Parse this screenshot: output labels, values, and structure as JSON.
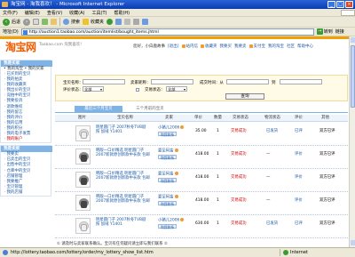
{
  "window": {
    "title": "淘宝网 - 淘我喜欢！ - Microsoft Internet Explorer"
  },
  "menubar": [
    "文件(F)",
    "编辑(E)",
    "查看(V)",
    "收藏(A)",
    "工具(T)",
    "帮助(H)"
  ],
  "toolbar": {
    "back": "后退",
    "search": "搜索",
    "favorites": "收藏夹"
  },
  "address": {
    "label": "地址(D)",
    "url": "http://auction1.taobao.com/auction/itemlist/bought_items.jhtml",
    "go": "转到",
    "links": "链接"
  },
  "page": {
    "logo": "淘宝网",
    "logo_sub": "Taobao.com 淘我喜欢!",
    "topnav": [
      "您好，小白鹿故事",
      "[退出]",
      "站内信",
      "收藏夹",
      "我要买",
      "我要卖",
      "支付宝",
      "我的淘宝",
      "社区",
      "帮助中心"
    ],
    "sidebar": {
      "buyer_head": "我是买家",
      "buyer_sub": "• 我的淘宝 • 我的买家",
      "buyer_items": [
        "已买到的宝贝",
        "我的拍卖",
        "我的收藏夹",
        "我出价的宝贝",
        "竞拍中的宝贝",
        "我要投诉",
        "退款维权",
        "我的留言",
        "我的评价",
        "我的信用",
        "我的积分",
        "我的电子发票",
        "我的账户"
      ],
      "seller_head": "我是卖家",
      "seller_items": [
        "我要卖",
        "已卖出的宝贝",
        "出售中的宝贝",
        "仓库中的宝贝",
        "店铺管理",
        "我要推广",
        "宝贝管理",
        "我的店铺"
      ]
    },
    "filter": {
      "labels": {
        "name": "宝贝名称：",
        "seller": "卖家昵称：",
        "time": "成交时间：从",
        "to": "到",
        "eval": "评价状态：",
        "status": "交易状态："
      },
      "eval_value": "全部",
      "status_value": "全部",
      "search_button": "查询"
    },
    "tabs": [
      "最近三个月宝贝",
      "三个月前的宝贝"
    ],
    "table_headers": [
      "图片",
      "宝贝名称",
      "卖家",
      "单价",
      "数量",
      "交易状态",
      "物流状态",
      "评价",
      "其他"
    ],
    "rows": [
      {
        "name": "明星圆门子 2007秋冬TVB剧照 加绒 Y1401",
        "seller": "小猪儿2006",
        "price": "35.00",
        "qty": "1",
        "status": "交易成功",
        "ship": "已发货",
        "eval": "已评",
        "other": "双方已评",
        "img": "light"
      },
      {
        "name": "韩版一口价精选 明星圆门子 2007新款原创新款中长款 包邮",
        "seller": "夏至阿蛮",
        "price": "418.00",
        "qty": "1",
        "status": "交易成功",
        "ship": "—",
        "eval": "评价",
        "other": "双方已评",
        "img": "dark"
      },
      {
        "name": "韩版一口价精选 明星圆门子 2007新款原创新款中长款 包邮",
        "seller": "夏至阿蛮",
        "price": "418.00",
        "qty": "1",
        "status": "交易成功",
        "ship": "—",
        "eval": "评价",
        "other": "双方已评",
        "img": "dark"
      },
      {
        "name": "韩版一口价精选 明星圆门子 2007新款原创新款中长款 包邮",
        "seller": "夏至阿蛮",
        "price": "418.00",
        "qty": "1",
        "status": "交易成功",
        "ship": "—",
        "eval": "评价",
        "other": "双方已评",
        "img": "dark"
      },
      {
        "name": "明星圆门子 2007秋冬TVB剧照 加绒 Y1401",
        "seller": "小猪儿2006",
        "price": "630.00",
        "qty": "1",
        "status": "交易成功",
        "ship": "已发货",
        "eval": "已评",
        "other": "双方已评",
        "img": "light"
      }
    ],
    "contact_label": "和我联系",
    "footer_note": "① 请及时与卖家联系确认。宝贝有任何疑问请立即与我们联系 ②"
  },
  "statusbar": {
    "text": "http://lottery.taobao.com/lottery/order/my_lottery_show_list.htm",
    "zone": "Internet"
  }
}
